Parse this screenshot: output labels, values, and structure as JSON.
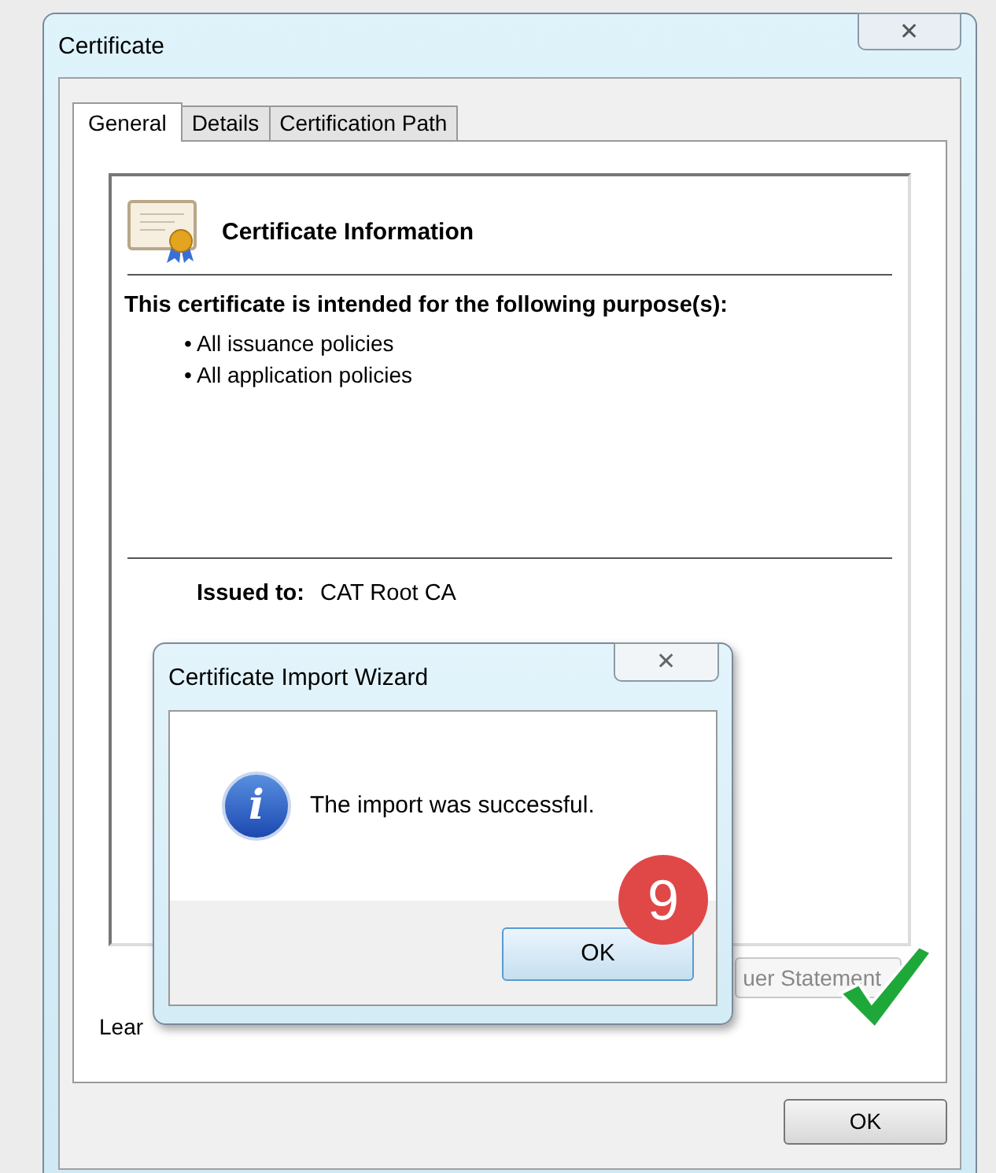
{
  "window": {
    "title": "Certificate",
    "close_glyph": "✕"
  },
  "tabs": [
    {
      "label": "General",
      "selected": true
    },
    {
      "label": "Details",
      "selected": false
    },
    {
      "label": "Certification Path",
      "selected": false
    }
  ],
  "info": {
    "heading": "Certificate Information",
    "purpose_title": "This certificate is intended for the following purpose(s):",
    "purposes": [
      "• All issuance policies",
      "• All application policies"
    ],
    "issued_to_label": "Issued to:",
    "issued_to_value": "CAT Root CA"
  },
  "issuer_button": "uer Statement",
  "learn_link": "Lear",
  "ok_button": "OK",
  "wizard": {
    "title": "Certificate Import Wizard",
    "close_glyph": "✕",
    "message": "The import was successful.",
    "icon_glyph": "i",
    "ok_button": "OK"
  },
  "step_badge": "9"
}
